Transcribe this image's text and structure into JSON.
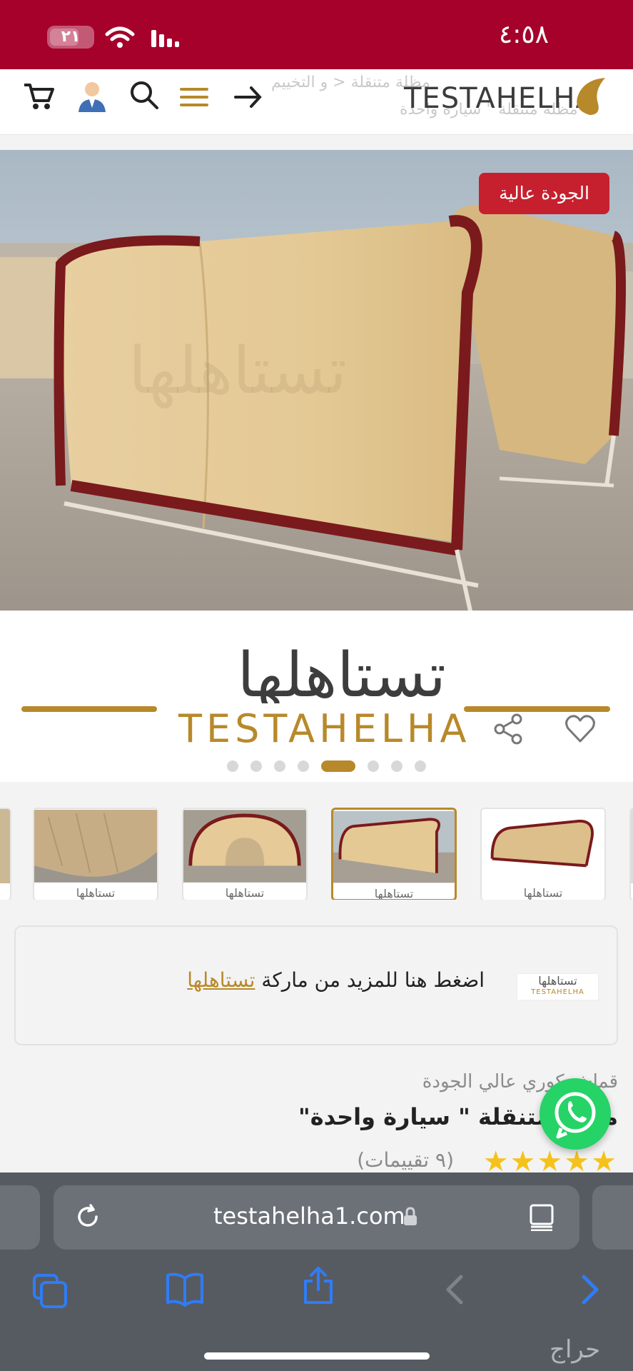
{
  "status_bar": {
    "time": "٤:٥٨",
    "battery": "٢١"
  },
  "header": {
    "brand_latin": "TESTAHELHA",
    "breadcrumb_1": "مظلة متنقلة  <   و التخييم",
    "breadcrumb_2": "مظلة متنقلة \" سيارة واحدة"
  },
  "hero": {
    "badge": "الجودة عالية"
  },
  "banner": {
    "brand_ar": "تستاهلها",
    "brand_latin": "TESTAHELHA",
    "slide_count": 8,
    "active_slide": 5
  },
  "thumbnails": [
    {
      "caption": "تستاهلها"
    },
    {
      "caption": "تستاهلها"
    },
    {
      "caption": "تستاهلها"
    },
    {
      "caption": "تستاهلها"
    }
  ],
  "brand_box": {
    "text": "اضغط هنا للمزيد من ماركة",
    "link": "تستاهلها",
    "logo_ar": "تستاهلها",
    "logo_latin": "TESTAHELHA"
  },
  "product": {
    "category": "قماش كوري عالي الجودة",
    "title": "مظلة متنقلة \" سيارة واحدة\"",
    "stars": "★★★★★",
    "rating_count": "(٩ تقييمات)"
  },
  "safari": {
    "url": "testahelha1.com"
  },
  "watermark": "حراج",
  "colors": {
    "status_bar": "#a5012b",
    "gold": "#b8892a",
    "badge": "#c6202e",
    "whatsapp": "#25d366",
    "safari_blue": "#2f7cf6"
  }
}
